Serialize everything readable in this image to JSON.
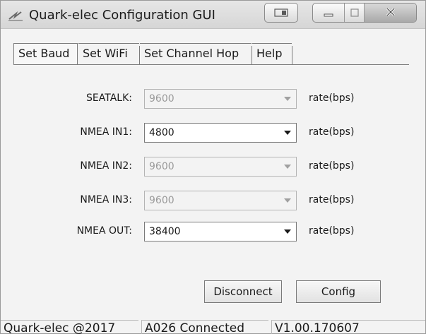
{
  "window": {
    "title": "Quark-elec Configuration GUI"
  },
  "tabs": [
    {
      "label": "Set Baud",
      "active": true
    },
    {
      "label": "Set WiFi",
      "active": false
    },
    {
      "label": "Set Channel Hop",
      "active": false
    },
    {
      "label": "Help",
      "active": false
    }
  ],
  "baud": {
    "rows": [
      {
        "label": "SEATALK:",
        "value": "9600",
        "enabled": false,
        "unit": "rate(bps)"
      },
      {
        "label": "NMEA IN1:",
        "value": "4800",
        "enabled": true,
        "unit": "rate(bps)"
      },
      {
        "label": "NMEA IN2:",
        "value": "9600",
        "enabled": false,
        "unit": "rate(bps)"
      },
      {
        "label": "NMEA IN3:",
        "value": "9600",
        "enabled": false,
        "unit": "rate(bps)"
      },
      {
        "label": "NMEA OUT:",
        "value": "38400",
        "enabled": true,
        "unit": "rate(bps)"
      }
    ],
    "disconnect_label": "Disconnect",
    "config_label": "Config"
  },
  "status": {
    "copyright": "Quark-elec @2017",
    "connection": "A026 Connected",
    "version": "V1.00.170607"
  },
  "icons": {
    "app": "app-icon",
    "extra": "window-extra-icon",
    "minimize": "minimize-icon",
    "maximize": "maximize-icon",
    "close": "close-icon",
    "dropdown": "chevron-down-icon"
  }
}
